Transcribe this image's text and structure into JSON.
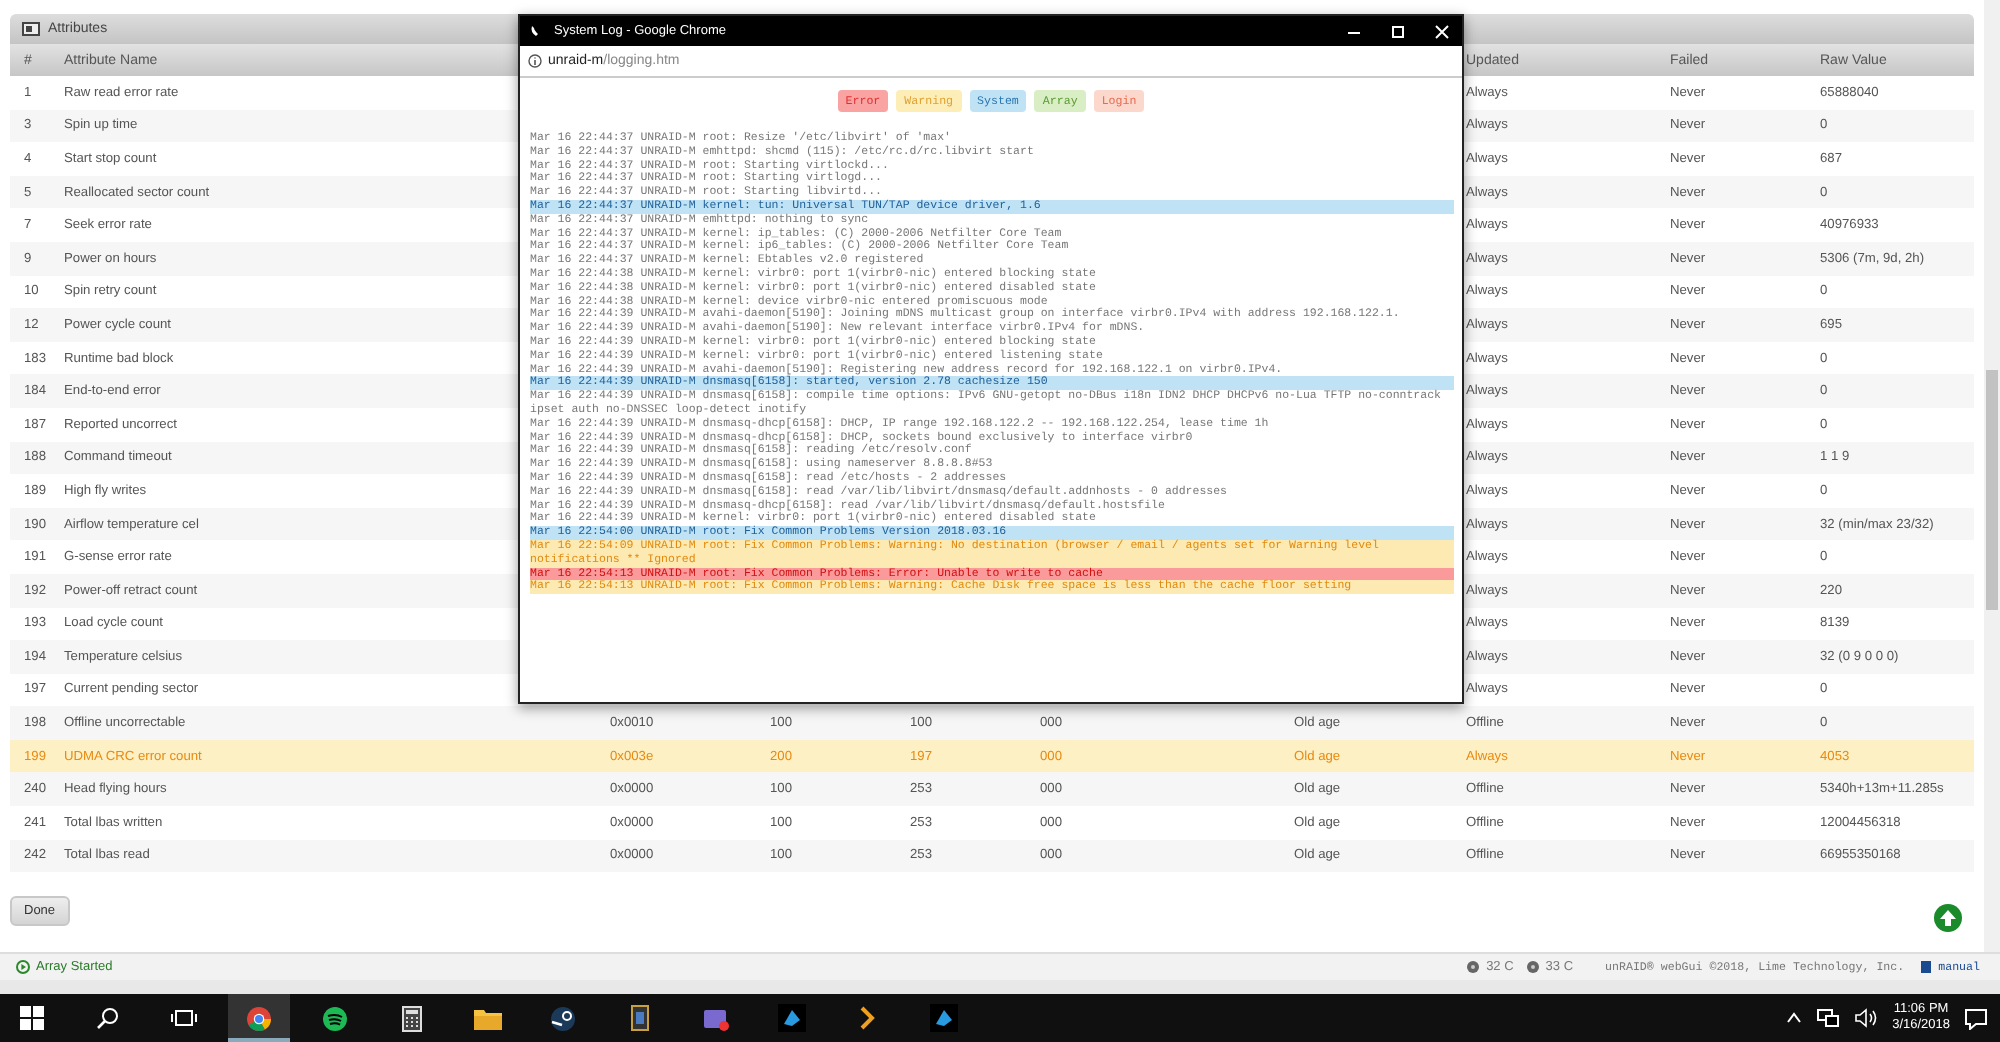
{
  "panel": {
    "title": "Attributes"
  },
  "table": {
    "columns": [
      "#",
      "Attribute Name",
      "Updated",
      "Failed",
      "Raw Value"
    ],
    "rows": [
      {
        "id": "1",
        "name": "Raw read error rate",
        "updated": "Always",
        "failed": "Never",
        "raw": "65888040",
        "highlighted": false
      },
      {
        "id": "3",
        "name": "Spin up time",
        "updated": "Always",
        "failed": "Never",
        "raw": "0",
        "highlighted": false
      },
      {
        "id": "4",
        "name": "Start stop count",
        "updated": "Always",
        "failed": "Never",
        "raw": "687",
        "highlighted": false
      },
      {
        "id": "5",
        "name": "Reallocated sector count",
        "updated": "Always",
        "failed": "Never",
        "raw": "0",
        "highlighted": false
      },
      {
        "id": "7",
        "name": "Seek error rate",
        "updated": "Always",
        "failed": "Never",
        "raw": "40976933",
        "highlighted": false
      },
      {
        "id": "9",
        "name": "Power on hours",
        "updated": "Always",
        "failed": "Never",
        "raw": "5306 (7m, 9d, 2h)",
        "highlighted": false
      },
      {
        "id": "10",
        "name": "Spin retry count",
        "updated": "Always",
        "failed": "Never",
        "raw": "0",
        "highlighted": false
      },
      {
        "id": "12",
        "name": "Power cycle count",
        "updated": "Always",
        "failed": "Never",
        "raw": "695",
        "highlighted": false
      },
      {
        "id": "183",
        "name": "Runtime bad block",
        "updated": "Always",
        "failed": "Never",
        "raw": "0",
        "highlighted": false
      },
      {
        "id": "184",
        "name": "End-to-end error",
        "updated": "Always",
        "failed": "Never",
        "raw": "0",
        "highlighted": false
      },
      {
        "id": "187",
        "name": "Reported uncorrect",
        "updated": "Always",
        "failed": "Never",
        "raw": "0",
        "highlighted": false
      },
      {
        "id": "188",
        "name": "Command timeout",
        "updated": "Always",
        "failed": "Never",
        "raw": "1 1 9",
        "highlighted": false
      },
      {
        "id": "189",
        "name": "High fly writes",
        "updated": "Always",
        "failed": "Never",
        "raw": "0",
        "highlighted": false
      },
      {
        "id": "190",
        "name": "Airflow temperature cel",
        "updated": "Always",
        "failed": "Never",
        "raw": "32 (min/max 23/32)",
        "highlighted": false
      },
      {
        "id": "191",
        "name": "G-sense error rate",
        "updated": "Always",
        "failed": "Never",
        "raw": "0",
        "highlighted": false
      },
      {
        "id": "192",
        "name": "Power-off retract count",
        "updated": "Always",
        "failed": "Never",
        "raw": "220",
        "highlighted": false
      },
      {
        "id": "193",
        "name": "Load cycle count",
        "updated": "Always",
        "failed": "Never",
        "raw": "8139",
        "highlighted": false
      },
      {
        "id": "194",
        "name": "Temperature celsius",
        "updated": "Always",
        "failed": "Never",
        "raw": "32 (0 9 0 0 0)",
        "highlighted": false
      },
      {
        "id": "197",
        "name": "Current pending sector",
        "updated": "Always",
        "failed": "Never",
        "raw": "0",
        "highlighted": false
      },
      {
        "id": "198",
        "name": "Offline uncorrectable",
        "flag": "0x0010",
        "value": "100",
        "worst": "100",
        "threshold": "000",
        "type": "Old age",
        "updated": "Offline",
        "failed": "Never",
        "raw": "0",
        "highlighted": false
      },
      {
        "id": "199",
        "name": "UDMA CRC error count",
        "flag": "0x003e",
        "value": "200",
        "worst": "197",
        "threshold": "000",
        "type": "Old age",
        "updated": "Always",
        "failed": "Never",
        "raw": "4053",
        "highlighted": true
      },
      {
        "id": "240",
        "name": "Head flying hours",
        "flag": "0x0000",
        "value": "100",
        "worst": "253",
        "threshold": "000",
        "type": "Old age",
        "updated": "Offline",
        "failed": "Never",
        "raw": "5340h+13m+11.285s",
        "highlighted": false
      },
      {
        "id": "241",
        "name": "Total lbas written",
        "flag": "0x0000",
        "value": "100",
        "worst": "253",
        "threshold": "000",
        "type": "Old age",
        "updated": "Offline",
        "failed": "Never",
        "raw": "12004456318",
        "highlighted": false
      },
      {
        "id": "242",
        "name": "Total lbas read",
        "flag": "0x0000",
        "value": "100",
        "worst": "253",
        "threshold": "000",
        "type": "Old age",
        "updated": "Offline",
        "failed": "Never",
        "raw": "66955350168",
        "highlighted": false
      }
    ]
  },
  "done_button": "Done",
  "log_window": {
    "title": "System Log - Google Chrome",
    "url_host": "unraid-m",
    "url_path": "/logging.htm",
    "filters": [
      {
        "label": "Error",
        "kind": "error"
      },
      {
        "label": "Warning",
        "kind": "warning"
      },
      {
        "label": "System",
        "kind": "system"
      },
      {
        "label": "Array",
        "kind": "array"
      },
      {
        "label": "Login",
        "kind": "login"
      }
    ],
    "lines": [
      {
        "text": "Mar 16 22:44:37 UNRAID-M root: Resize '/etc/libvirt' of 'max'",
        "kind": "normal"
      },
      {
        "text": "Mar 16 22:44:37 UNRAID-M emhttpd: shcmd (115): /etc/rc.d/rc.libvirt start",
        "kind": "normal"
      },
      {
        "text": "Mar 16 22:44:37 UNRAID-M root: Starting virtlockd...",
        "kind": "normal"
      },
      {
        "text": "Mar 16 22:44:37 UNRAID-M root: Starting virtlogd...",
        "kind": "normal"
      },
      {
        "text": "Mar 16 22:44:37 UNRAID-M root: Starting libvirtd...",
        "kind": "normal"
      },
      {
        "text": "Mar 16 22:44:37 UNRAID-M kernel: tun: Universal TUN/TAP device driver, 1.6",
        "kind": "system"
      },
      {
        "text": "Mar 16 22:44:37 UNRAID-M emhttpd: nothing to sync",
        "kind": "normal"
      },
      {
        "text": "Mar 16 22:44:37 UNRAID-M kernel: ip_tables: (C) 2000-2006 Netfilter Core Team",
        "kind": "normal"
      },
      {
        "text": "Mar 16 22:44:37 UNRAID-M kernel: ip6_tables: (C) 2000-2006 Netfilter Core Team",
        "kind": "normal"
      },
      {
        "text": "Mar 16 22:44:37 UNRAID-M kernel: Ebtables v2.0 registered",
        "kind": "normal"
      },
      {
        "text": "Mar 16 22:44:38 UNRAID-M kernel: virbr0: port 1(virbr0-nic) entered blocking state",
        "kind": "normal"
      },
      {
        "text": "Mar 16 22:44:38 UNRAID-M kernel: virbr0: port 1(virbr0-nic) entered disabled state",
        "kind": "normal"
      },
      {
        "text": "Mar 16 22:44:38 UNRAID-M kernel: device virbr0-nic entered promiscuous mode",
        "kind": "normal"
      },
      {
        "text": "Mar 16 22:44:39 UNRAID-M avahi-daemon[5190]: Joining mDNS multicast group on interface virbr0.IPv4 with address 192.168.122.1.",
        "kind": "normal"
      },
      {
        "text": "Mar 16 22:44:39 UNRAID-M avahi-daemon[5190]: New relevant interface virbr0.IPv4 for mDNS.",
        "kind": "normal"
      },
      {
        "text": "Mar 16 22:44:39 UNRAID-M kernel: virbr0: port 1(virbr0-nic) entered blocking state",
        "kind": "normal"
      },
      {
        "text": "Mar 16 22:44:39 UNRAID-M kernel: virbr0: port 1(virbr0-nic) entered listening state",
        "kind": "normal"
      },
      {
        "text": "Mar 16 22:44:39 UNRAID-M avahi-daemon[5190]: Registering new address record for 192.168.122.1 on virbr0.IPv4.",
        "kind": "normal"
      },
      {
        "text": "Mar 16 22:44:39 UNRAID-M dnsmasq[6158]: started, version 2.78 cachesize 150",
        "kind": "system"
      },
      {
        "text": "Mar 16 22:44:39 UNRAID-M dnsmasq[6158]: compile time options: IPv6 GNU-getopt no-DBus i18n IDN2 DHCP DHCPv6 no-Lua TFTP no-conntrack ipset auth no-DNSSEC loop-detect inotify",
        "kind": "normal"
      },
      {
        "text": "Mar 16 22:44:39 UNRAID-M dnsmasq-dhcp[6158]: DHCP, IP range 192.168.122.2 -- 192.168.122.254, lease time 1h",
        "kind": "normal"
      },
      {
        "text": "Mar 16 22:44:39 UNRAID-M dnsmasq-dhcp[6158]: DHCP, sockets bound exclusively to interface virbr0",
        "kind": "normal"
      },
      {
        "text": "Mar 16 22:44:39 UNRAID-M dnsmasq[6158]: reading /etc/resolv.conf",
        "kind": "normal"
      },
      {
        "text": "Mar 16 22:44:39 UNRAID-M dnsmasq[6158]: using nameserver 8.8.8.8#53",
        "kind": "normal"
      },
      {
        "text": "Mar 16 22:44:39 UNRAID-M dnsmasq[6158]: read /etc/hosts - 2 addresses",
        "kind": "normal"
      },
      {
        "text": "Mar 16 22:44:39 UNRAID-M dnsmasq[6158]: read /var/lib/libvirt/dnsmasq/default.addnhosts - 0 addresses",
        "kind": "normal"
      },
      {
        "text": "Mar 16 22:44:39 UNRAID-M dnsmasq-dhcp[6158]: read /var/lib/libvirt/dnsmasq/default.hostsfile",
        "kind": "normal"
      },
      {
        "text": "Mar 16 22:44:39 UNRAID-M kernel: virbr0: port 1(virbr0-nic) entered disabled state",
        "kind": "normal"
      },
      {
        "text": "Mar 16 22:54:00 UNRAID-M root: Fix Common Problems Version 2018.03.16",
        "kind": "system"
      },
      {
        "text": "Mar 16 22:54:09 UNRAID-M root: Fix Common Problems: Warning: No destination (browser / email / agents set for Warning level notifications ** Ignored",
        "kind": "warning"
      },
      {
        "text": "Mar 16 22:54:13 UNRAID-M root: Fix Common Problems: Error: Unable to write to cache",
        "kind": "error"
      },
      {
        "text": "Mar 16 22:54:13 UNRAID-M root: Fix Common Problems: Warning: Cache Disk free space is less than the cache floor setting",
        "kind": "warning"
      }
    ]
  },
  "status_bar": {
    "array_status": "Array Started",
    "temps": [
      "32 C",
      "33 C"
    ],
    "copyright": "unRAID® webGui ©2018, Lime Technology, Inc.",
    "manual": "manual"
  },
  "taskbar": {
    "time": "11:06 PM",
    "date": "3/16/2018"
  }
}
